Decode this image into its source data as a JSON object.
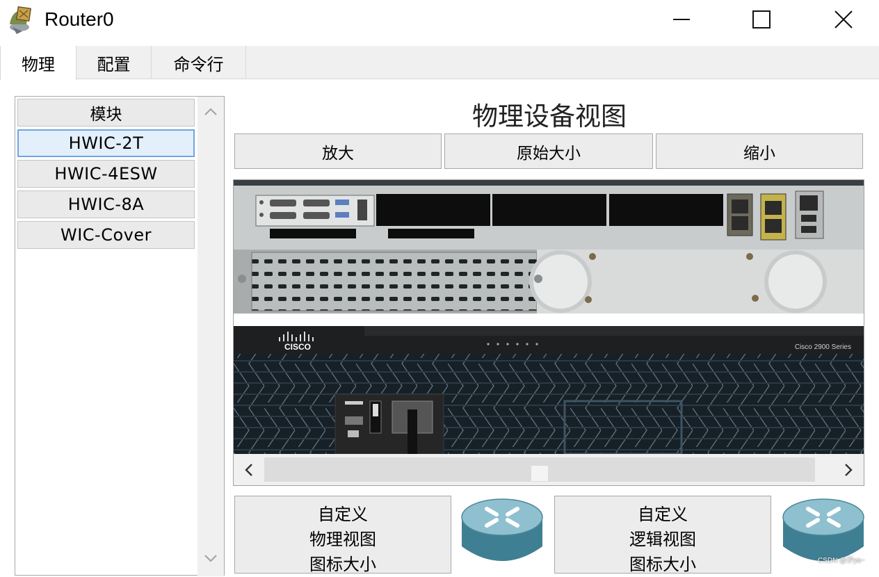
{
  "window": {
    "title": "Router0",
    "icon": "router-app-icon",
    "controls": {
      "minimize": "minimize-icon",
      "maximize": "maximize-icon",
      "close": "close-icon"
    }
  },
  "tabs": [
    {
      "label": "物理",
      "active": true
    },
    {
      "label": "配置",
      "active": false
    },
    {
      "label": "命令行",
      "active": false
    }
  ],
  "modules": {
    "header": "模块",
    "items": [
      {
        "label": "HWIC-2T",
        "selected": true
      },
      {
        "label": "HWIC-4ESW",
        "selected": false
      },
      {
        "label": "HWIC-8A",
        "selected": false
      },
      {
        "label": "WIC-Cover",
        "selected": false
      }
    ]
  },
  "physical_view": {
    "title": "物理设备视图",
    "zoom_in": "放大",
    "original_size": "原始大小",
    "zoom_out": "缩小",
    "device": {
      "brand": "CISCO",
      "series": "Cisco 2900 Series"
    }
  },
  "custom": {
    "physical_icon_size": [
      "自定义",
      "物理视图",
      "图标大小"
    ],
    "logical_icon_size": [
      "自定义",
      "逻辑视图",
      "图标大小"
    ]
  },
  "watermark": "CSDN @汐ya~",
  "colors": {
    "accent_selected": "#6fa6de",
    "chassis_dark": "#1b1f23",
    "chassis_grey": "#b8bcbc",
    "router_icon": "#5e9bb0"
  }
}
